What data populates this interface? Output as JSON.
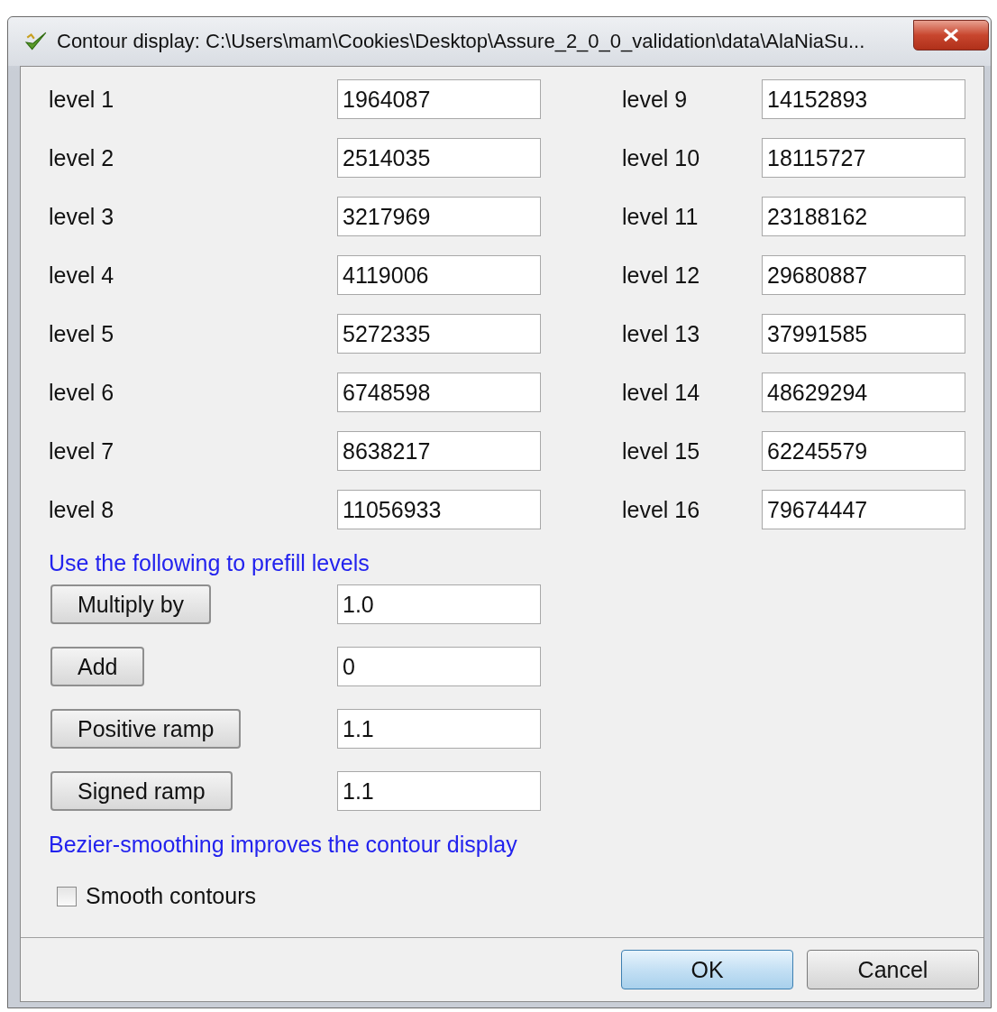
{
  "window": {
    "title": "Contour display: C:\\Users\\mam\\Cookies\\Desktop\\Assure_2_0_0_validation\\data\\AlaNiaSu..."
  },
  "level_columns": [
    [
      {
        "label": "level 1",
        "value": "1964087"
      },
      {
        "label": "level 2",
        "value": "2514035"
      },
      {
        "label": "level 3",
        "value": "3217969"
      },
      {
        "label": "level 4",
        "value": "4119006"
      },
      {
        "label": "level 5",
        "value": "5272335"
      },
      {
        "label": "level 6",
        "value": "6748598"
      },
      {
        "label": "level 7",
        "value": "8638217"
      },
      {
        "label": "level 8",
        "value": "11056933"
      }
    ],
    [
      {
        "label": "level 9",
        "value": "14152893"
      },
      {
        "label": "level 10",
        "value": "18115727"
      },
      {
        "label": "level 11",
        "value": "23188162"
      },
      {
        "label": "level 12",
        "value": "29680887"
      },
      {
        "label": "level 13",
        "value": "37991585"
      },
      {
        "label": "level 14",
        "value": "48629294"
      },
      {
        "label": "level 15",
        "value": "62245579"
      },
      {
        "label": "level 16",
        "value": "79674447"
      }
    ]
  ],
  "prefill_heading": "Use the following to prefill levels",
  "prefill_rows": [
    {
      "button": "Multiply by",
      "value": "1.0"
    },
    {
      "button": "Add",
      "value": "0"
    },
    {
      "button": "Positive ramp",
      "value": "1.1"
    },
    {
      "button": "Signed ramp",
      "value": "1.1"
    }
  ],
  "smoothing_note": "Bezier-smoothing improves the contour display",
  "smooth_checkbox": {
    "label": "Smooth contours",
    "checked": false
  },
  "buttons": [
    {
      "label": "OK",
      "default": true
    },
    {
      "label": "Cancel",
      "default": false
    }
  ]
}
